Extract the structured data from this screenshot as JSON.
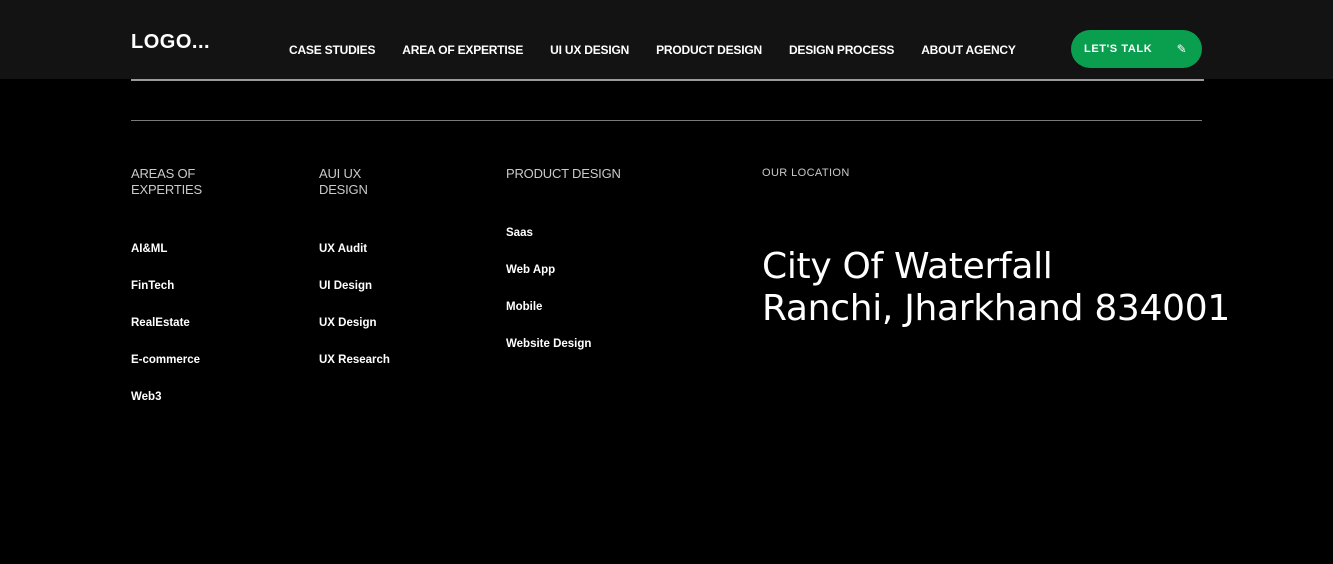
{
  "header": {
    "logo": "LOGO...",
    "nav": [
      {
        "label": "CASE STUDIES"
      },
      {
        "label": "AREA OF EXPERTISE"
      },
      {
        "label": "UI UX DESIGN"
      },
      {
        "label": "PRODUCT DESIGN"
      },
      {
        "label": "DESIGN PROCESS"
      },
      {
        "label": "ABOUT AGENCY"
      }
    ],
    "cta": {
      "label": "LET'S  TALK",
      "icon": "pencil-icon"
    }
  },
  "colors": {
    "header_bg": "#131313",
    "page_bg": "#000000",
    "cta_bg": "#0a9f4e"
  },
  "footer": {
    "columns": [
      {
        "title": "AREAS OF EXPERTIES",
        "title_lines": [
          "AREAS OF",
          "EXPERTIES"
        ],
        "items": [
          "AI&ML",
          "FinTech",
          "RealEstate",
          "E-commerce",
          "Web3"
        ]
      },
      {
        "title": "AUI UX DESIGN",
        "title_lines": [
          "AUI UX",
          "DESIGN"
        ],
        "items": [
          "UX Audit",
          "UI Design",
          "UX Design",
          "UX Research"
        ]
      },
      {
        "title": "PRODUCT DESIGN",
        "title_lines": [
          "PRODUCT DESIGN"
        ],
        "items": [
          "Saas",
          "Web App",
          "Mobile",
          "Website Design"
        ]
      }
    ],
    "location": {
      "title": "OUR LOCATION",
      "line1": "City Of  Waterfall",
      "line2": "Ranchi, Jharkhand 834001"
    }
  }
}
